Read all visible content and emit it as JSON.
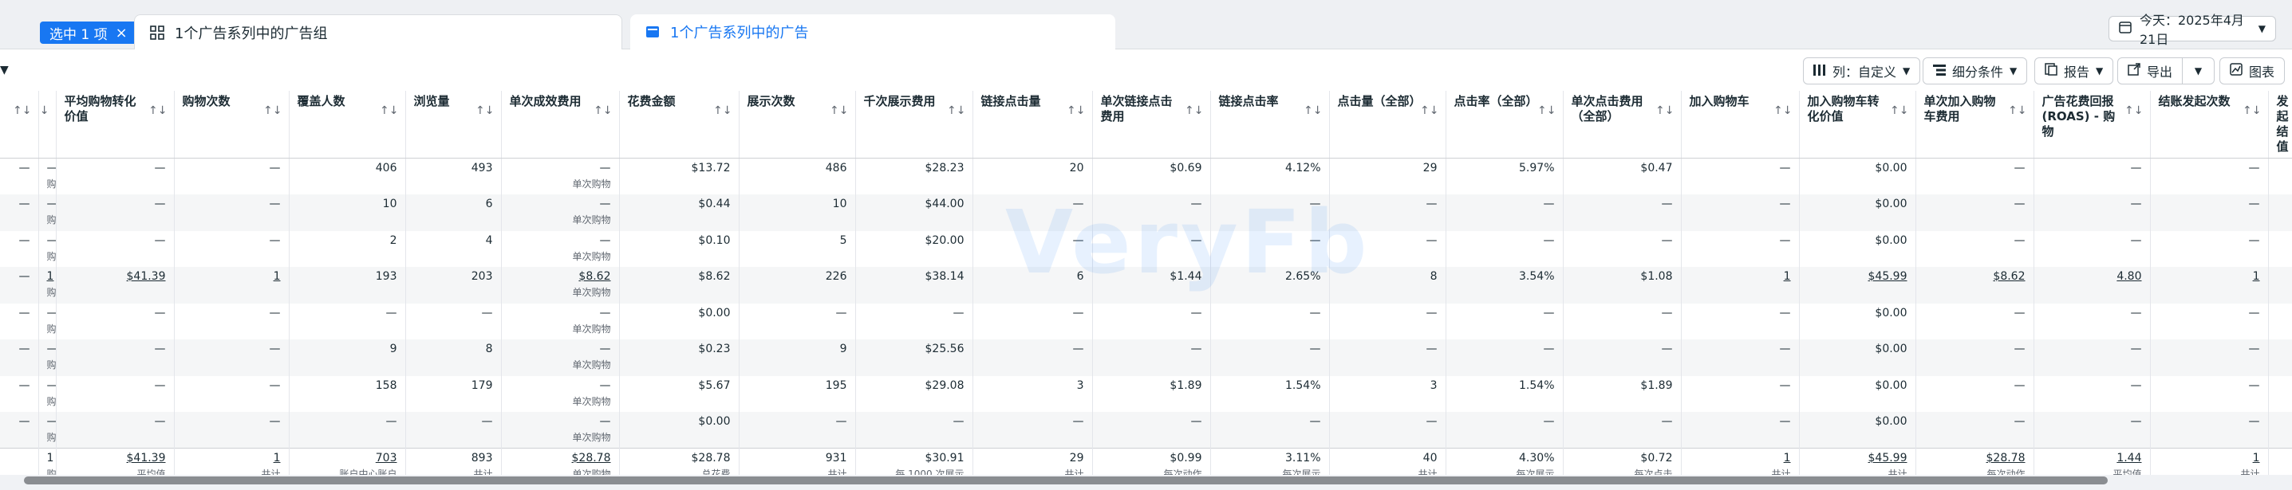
{
  "selection": {
    "label": "选中 1 项",
    "close": "×"
  },
  "tabs": [
    {
      "label": "1个广告系列中的广告组"
    },
    {
      "label": "1个广告系列中的广告"
    }
  ],
  "date_picker": {
    "label": "今天：2025年4月21日"
  },
  "toolbar": {
    "columns_label": "列：自定义",
    "breakdown_label": "细分条件",
    "report_label": "报告",
    "export_label": "导出",
    "chart_label": "图表"
  },
  "watermark": "VeryFb",
  "columns": [
    {
      "label": ""
    },
    {
      "label": ""
    },
    {
      "label": "平均购物转化价值"
    },
    {
      "label": "购物次数"
    },
    {
      "label": "覆盖人数"
    },
    {
      "label": "浏览量"
    },
    {
      "label": "单次成效费用"
    },
    {
      "label": "花费金额"
    },
    {
      "label": "展示次数"
    },
    {
      "label": "千次展示费用"
    },
    {
      "label": "链接点击量"
    },
    {
      "label": "单次链接点击费用"
    },
    {
      "label": "链接点击率"
    },
    {
      "label": "点击量（全部）"
    },
    {
      "label": "点击率（全部）"
    },
    {
      "label": "单次点击费用（全部）"
    },
    {
      "label": "加入购物车"
    },
    {
      "label": "加入购物车转化价值"
    },
    {
      "label": "单次加入购物车费用"
    },
    {
      "label": "广告花费回报 (ROAS) - 购物"
    },
    {
      "label": "结账发起次数"
    },
    {
      "label": "发起结值"
    }
  ],
  "rows": [
    {
      "cells": [
        {
          "v": "—"
        },
        {
          "v": "—",
          "s": "购物"
        },
        {
          "v": "—"
        },
        {
          "v": "—"
        },
        {
          "v": "406"
        },
        {
          "v": "493"
        },
        {
          "v": "—",
          "s": "单次购物"
        },
        {
          "v": "$13.72"
        },
        {
          "v": "486"
        },
        {
          "v": "$28.23"
        },
        {
          "v": "20"
        },
        {
          "v": "$0.69"
        },
        {
          "v": "4.12%"
        },
        {
          "v": "29"
        },
        {
          "v": "5.97%"
        },
        {
          "v": "$0.47"
        },
        {
          "v": "—"
        },
        {
          "v": "$0.00"
        },
        {
          "v": "—"
        },
        {
          "v": "—"
        },
        {
          "v": "—"
        },
        {
          "v": ""
        }
      ]
    },
    {
      "cells": [
        {
          "v": "—"
        },
        {
          "v": "—",
          "s": "购物"
        },
        {
          "v": "—"
        },
        {
          "v": "—"
        },
        {
          "v": "10"
        },
        {
          "v": "6"
        },
        {
          "v": "—",
          "s": "单次购物"
        },
        {
          "v": "$0.44"
        },
        {
          "v": "10"
        },
        {
          "v": "$44.00"
        },
        {
          "v": "—"
        },
        {
          "v": "—"
        },
        {
          "v": "—"
        },
        {
          "v": "—"
        },
        {
          "v": "—"
        },
        {
          "v": "—"
        },
        {
          "v": "—"
        },
        {
          "v": "$0.00"
        },
        {
          "v": "—"
        },
        {
          "v": "—"
        },
        {
          "v": "—"
        },
        {
          "v": ""
        }
      ]
    },
    {
      "cells": [
        {
          "v": "—"
        },
        {
          "v": "—",
          "s": "购物"
        },
        {
          "v": "—"
        },
        {
          "v": "—"
        },
        {
          "v": "2"
        },
        {
          "v": "4"
        },
        {
          "v": "—",
          "s": "单次购物"
        },
        {
          "v": "$0.10"
        },
        {
          "v": "5"
        },
        {
          "v": "$20.00"
        },
        {
          "v": "—"
        },
        {
          "v": "—"
        },
        {
          "v": "—"
        },
        {
          "v": "—"
        },
        {
          "v": "—"
        },
        {
          "v": "—"
        },
        {
          "v": "—"
        },
        {
          "v": "$0.00"
        },
        {
          "v": "—"
        },
        {
          "v": "—"
        },
        {
          "v": "—"
        },
        {
          "v": ""
        }
      ]
    },
    {
      "cells": [
        {
          "v": "—"
        },
        {
          "v": "1",
          "s": "购物",
          "u": true
        },
        {
          "v": "$41.39",
          "u": true
        },
        {
          "v": "1",
          "u": true
        },
        {
          "v": "193"
        },
        {
          "v": "203"
        },
        {
          "v": "$8.62",
          "s": "单次购物",
          "u": true
        },
        {
          "v": "$8.62"
        },
        {
          "v": "226"
        },
        {
          "v": "$38.14"
        },
        {
          "v": "6"
        },
        {
          "v": "$1.44"
        },
        {
          "v": "2.65%"
        },
        {
          "v": "8"
        },
        {
          "v": "3.54%"
        },
        {
          "v": "$1.08"
        },
        {
          "v": "1",
          "u": true
        },
        {
          "v": "$45.99",
          "u": true
        },
        {
          "v": "$8.62",
          "u": true
        },
        {
          "v": "4.80",
          "u": true
        },
        {
          "v": "1",
          "u": true
        },
        {
          "v": ""
        }
      ]
    },
    {
      "cells": [
        {
          "v": "—"
        },
        {
          "v": "—",
          "s": "购物"
        },
        {
          "v": "—"
        },
        {
          "v": "—"
        },
        {
          "v": "—"
        },
        {
          "v": "—"
        },
        {
          "v": "—",
          "s": "单次购物"
        },
        {
          "v": "$0.00"
        },
        {
          "v": "—"
        },
        {
          "v": "—"
        },
        {
          "v": "—"
        },
        {
          "v": "—"
        },
        {
          "v": "—"
        },
        {
          "v": "—"
        },
        {
          "v": "—"
        },
        {
          "v": "—"
        },
        {
          "v": "—"
        },
        {
          "v": "$0.00"
        },
        {
          "v": "—"
        },
        {
          "v": "—"
        },
        {
          "v": "—"
        },
        {
          "v": ""
        }
      ]
    },
    {
      "cells": [
        {
          "v": "—"
        },
        {
          "v": "—",
          "s": "购物"
        },
        {
          "v": "—"
        },
        {
          "v": "—"
        },
        {
          "v": "9"
        },
        {
          "v": "8"
        },
        {
          "v": "—",
          "s": "单次购物"
        },
        {
          "v": "$0.23"
        },
        {
          "v": "9"
        },
        {
          "v": "$25.56"
        },
        {
          "v": "—"
        },
        {
          "v": "—"
        },
        {
          "v": "—"
        },
        {
          "v": "—"
        },
        {
          "v": "—"
        },
        {
          "v": "—"
        },
        {
          "v": "—"
        },
        {
          "v": "$0.00"
        },
        {
          "v": "—"
        },
        {
          "v": "—"
        },
        {
          "v": "—"
        },
        {
          "v": ""
        }
      ]
    },
    {
      "cells": [
        {
          "v": "—"
        },
        {
          "v": "—",
          "s": "购物"
        },
        {
          "v": "—"
        },
        {
          "v": "—"
        },
        {
          "v": "158"
        },
        {
          "v": "179"
        },
        {
          "v": "—",
          "s": "单次购物"
        },
        {
          "v": "$5.67"
        },
        {
          "v": "195"
        },
        {
          "v": "$29.08"
        },
        {
          "v": "3"
        },
        {
          "v": "$1.89"
        },
        {
          "v": "1.54%"
        },
        {
          "v": "3"
        },
        {
          "v": "1.54%"
        },
        {
          "v": "$1.89"
        },
        {
          "v": "—"
        },
        {
          "v": "$0.00"
        },
        {
          "v": "—"
        },
        {
          "v": "—"
        },
        {
          "v": "—"
        },
        {
          "v": ""
        }
      ]
    },
    {
      "cells": [
        {
          "v": "—"
        },
        {
          "v": "—",
          "s": "购物"
        },
        {
          "v": "—"
        },
        {
          "v": "—"
        },
        {
          "v": "—"
        },
        {
          "v": "—"
        },
        {
          "v": "—",
          "s": "单次购物"
        },
        {
          "v": "$0.00"
        },
        {
          "v": "—"
        },
        {
          "v": "—"
        },
        {
          "v": "—"
        },
        {
          "v": "—"
        },
        {
          "v": "—"
        },
        {
          "v": "—"
        },
        {
          "v": "—"
        },
        {
          "v": "—"
        },
        {
          "v": "—"
        },
        {
          "v": "$0.00"
        },
        {
          "v": "—"
        },
        {
          "v": "—"
        },
        {
          "v": "—"
        },
        {
          "v": ""
        }
      ]
    }
  ],
  "totals": {
    "cells": [
      {
        "v": ""
      },
      {
        "v": "1",
        "s": "购物"
      },
      {
        "v": "$41.39",
        "s": "平均值",
        "u": true
      },
      {
        "v": "1",
        "s": "共计",
        "u": true
      },
      {
        "v": "703",
        "s": "账户中心账户",
        "u": true
      },
      {
        "v": "893",
        "s": "共计"
      },
      {
        "v": "$28.78",
        "s": "单次购物",
        "u": true
      },
      {
        "v": "$28.78",
        "s": "总花费"
      },
      {
        "v": "931",
        "s": "共计"
      },
      {
        "v": "$30.91",
        "s": "每 1000 次展示"
      },
      {
        "v": "29",
        "s": "共计"
      },
      {
        "v": "$0.99",
        "s": "每次动作"
      },
      {
        "v": "3.11%",
        "s": "每次展示"
      },
      {
        "v": "40",
        "s": "共计"
      },
      {
        "v": "4.30%",
        "s": "每次展示"
      },
      {
        "v": "$0.72",
        "s": "每次点击"
      },
      {
        "v": "1",
        "s": "共计",
        "u": true
      },
      {
        "v": "$45.99",
        "s": "共计",
        "u": true
      },
      {
        "v": "$28.78",
        "s": "每次动作",
        "u": true
      },
      {
        "v": "1.44",
        "s": "平均值",
        "u": true
      },
      {
        "v": "1",
        "s": "共计",
        "u": true
      },
      {
        "v": ""
      }
    ]
  }
}
